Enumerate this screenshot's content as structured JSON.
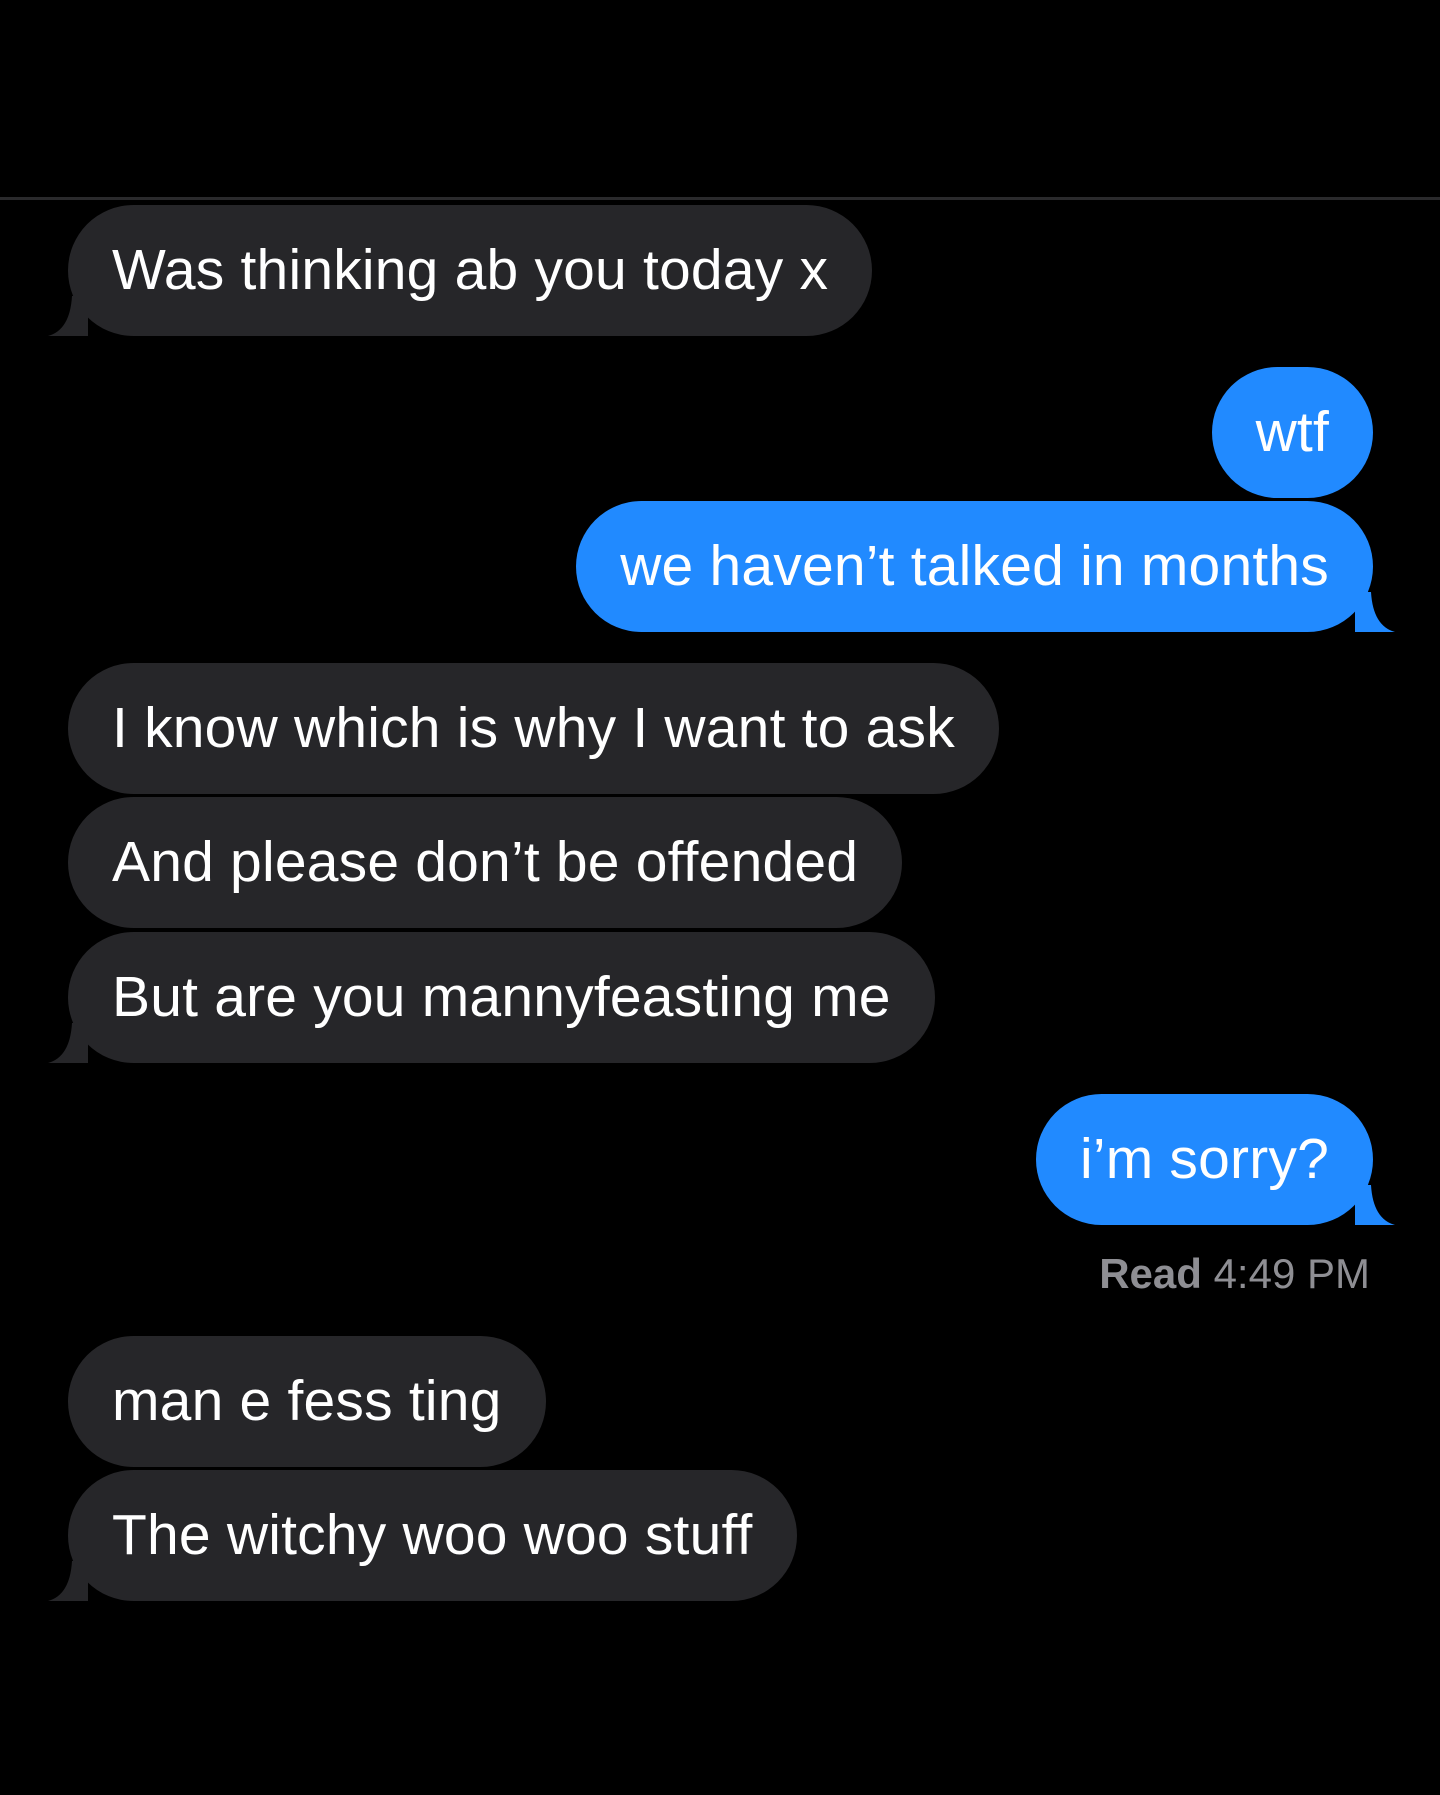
{
  "conversation": {
    "messages": [
      {
        "from": "them",
        "text": "Was thinking ab you today x"
      },
      {
        "from": "me",
        "text": "wtf"
      },
      {
        "from": "me",
        "text": "we haven’t talked in months"
      },
      {
        "from": "them",
        "text": "I know which is why I want to ask"
      },
      {
        "from": "them",
        "text": "And please don’t be offended"
      },
      {
        "from": "them",
        "text": "But are you mannyfeasting me"
      },
      {
        "from": "me",
        "text": "i’m sorry?"
      },
      {
        "from": "them",
        "text": "man e fess ting"
      },
      {
        "from": "them",
        "text": "The witchy woo woo stuff"
      }
    ],
    "read_receipt": {
      "label": "Read",
      "time": "4:49 PM"
    }
  },
  "colors": {
    "background": "#000000",
    "received_bubble": "#262629",
    "sent_bubble": "#218aff",
    "text": "#ffffff",
    "receipt_text": "#8e8e93"
  }
}
